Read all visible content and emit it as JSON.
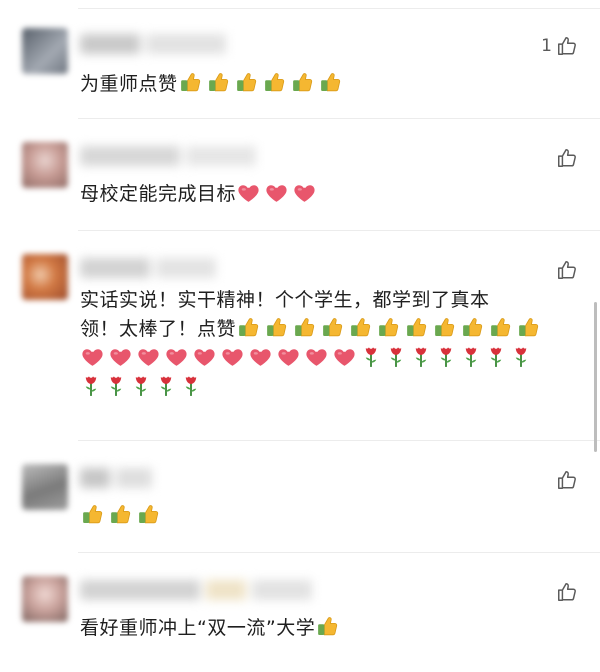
{
  "comments": [
    {
      "text_parts": [
        "为重师点赞"
      ],
      "trailing_emoji": [
        "thumbs",
        "thumbs",
        "thumbs",
        "thumbs",
        "thumbs",
        "thumbs"
      ],
      "like_count": "1",
      "avatar_color": "#6c7480",
      "name_hint": "夏雨 点赞"
    },
    {
      "text_parts": [
        "母校定能完成目标"
      ],
      "trailing_emoji": [
        "heart",
        "heart",
        "heart"
      ],
      "like_count": "",
      "avatar_color": "#b58d86"
    },
    {
      "line1": "实话实说！实干精神！个个学生，都学到了真本",
      "line2": "领！太棒了！点赞",
      "line2_emoji": [
        "thumbs",
        "thumbs",
        "thumbs",
        "thumbs",
        "thumbs",
        "thumbs",
        "thumbs",
        "thumbs",
        "thumbs",
        "thumbs",
        "thumbs"
      ],
      "line3_emoji": [
        "heart",
        "heart",
        "heart",
        "heart",
        "heart",
        "heart",
        "heart",
        "heart",
        "heart",
        "heart",
        "rose",
        "rose",
        "rose",
        "rose",
        "rose",
        "rose",
        "rose"
      ],
      "line4_emoji": [
        "rose",
        "rose",
        "rose",
        "rose",
        "rose"
      ],
      "like_count": "",
      "avatar_color": "#c96b3a"
    },
    {
      "text_parts": [
        ""
      ],
      "trailing_emoji": [
        "thumbs",
        "thumbs",
        "thumbs"
      ],
      "like_count": "",
      "avatar_color": "#8a8a8a"
    },
    {
      "text_before": "看好重师冲上",
      "text_quote": "“双一流”",
      "text_after": "大学",
      "trailing_emoji": [
        "thumbs"
      ],
      "like_count": "",
      "avatar_color": "#a88a86"
    }
  ],
  "colors": {
    "text": "#1f1f1f",
    "like_icon": "#5a5a5a",
    "divider": "#ececec",
    "thumb_yellow": "#f5b731",
    "thumb_cuff": "#6aa84f",
    "heart": "#e8566c",
    "rose": "#d8313b"
  }
}
